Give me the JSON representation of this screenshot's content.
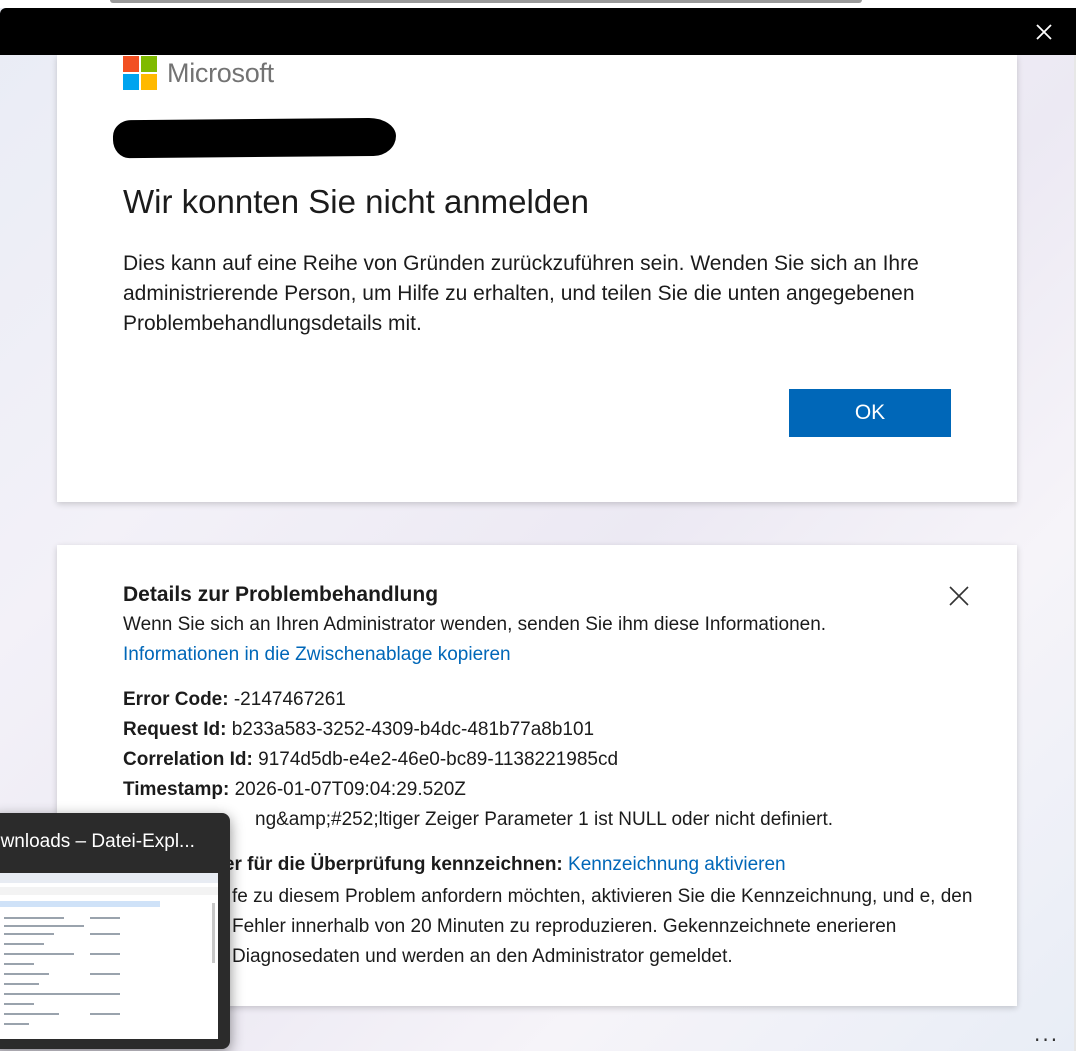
{
  "window": {
    "close_icon": "close-icon"
  },
  "brand": {
    "logo_text": "Microsoft",
    "colors": [
      "#f25022",
      "#7fba00",
      "#00a4ef",
      "#ffb900"
    ]
  },
  "dialog": {
    "heading": "Wir konnten Sie nicht anmelden",
    "message": "Dies kann auf eine Reihe von Gründen zurückzuführen sein. Wenden Sie sich an Ihre administrierende Person, um Hilfe zu erhalten, und teilen Sie die unten angegebenen Problembehandlungsdetails mit.",
    "ok_label": "OK",
    "accent_color": "#0067b8"
  },
  "details": {
    "title": "Details zur Problembehandlung",
    "subtitle": "Wenn Sie sich an Ihren Administrator wenden, senden Sie ihm diese Informationen.",
    "copy_link": "Informationen in die Zwischenablage kopieren",
    "error_code_label": "Error Code:",
    "error_code": "-2147467261",
    "request_id_label": "Request Id:",
    "request_id": "b233a583-3252-4309-b4dc-481b77a8b101",
    "correlation_id_label": "Correlation Id:",
    "correlation_id": "9174d5db-e4e2-46e0-bc89-1138221985cd",
    "timestamp_label": "Timestamp:",
    "timestamp": "2026-01-07T09:04:29.520Z",
    "message_partial": "ng&amp;#252;ltiger Zeiger Parameter 1 ist NULL oder nicht definiert.",
    "flag_label_partial": "nler für die Überprüfung kennzeichnen:",
    "flag_link": "Kennzeichnung aktivieren",
    "flag_text_partial": "fe zu diesem Problem anfordern möchten, aktivieren Sie die Kennzeichnung, und e, den Fehler innerhalb von 20 Minuten zu reproduzieren. Gekennzeichnete enerieren Diagnosedaten und werden an den Administrator gemeldet."
  },
  "taskbar_preview": {
    "title": "ownloads – Datei-Expl..."
  },
  "more_label": "..."
}
